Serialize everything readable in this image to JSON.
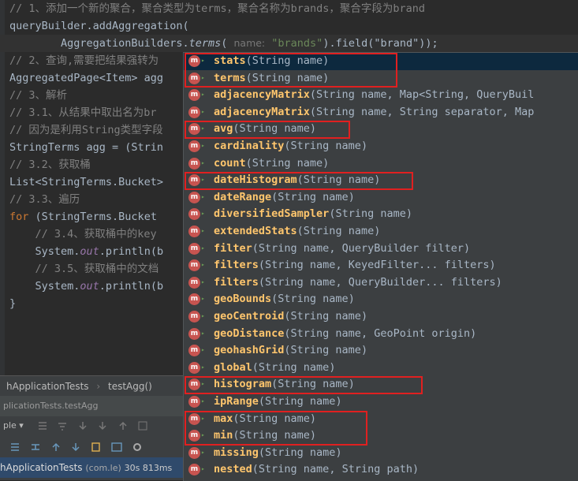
{
  "code": {
    "line1": "// 1、添加一个新的聚合，聚合类型为terms，聚合名称为brands，聚合字段为brand",
    "line2": "queryBuilder.addAggregation(",
    "line3_pre": "        AggregationBuilders.",
    "line3_method": "terms",
    "line3_paren": "( ",
    "line3_hint": "name:",
    "line3_string": " \"brands\"",
    "line3_post": ").field(\"brand\"));",
    "line4": "// 2、查询,需要把结果强转为",
    "line5": "AggregatedPage<Item> agg",
    "line6": "// 3、解析",
    "line7": "// 3.1、从结果中取出名为br",
    "line8": "// 因为是利用String类型字段",
    "line9": "StringTerms agg = (Strin",
    "line10": "// 3.2、获取桶",
    "line11": "List<StringTerms.Bucket>",
    "line12": "// 3.3、遍历",
    "line13_kw": "for",
    "line13_rest": " (StringTerms.Bucket",
    "line14": "    // 3.4、获取桶中的key",
    "line15_pre": "    System.",
    "line15_field": "out",
    "line15_post": ".println(b",
    "line16": "    // 3.5、获取桶中的文档",
    "line17_pre": "    System.",
    "line17_field": "out",
    "line17_post": ".println(b",
    "line18": "}"
  },
  "completion": {
    "badge_letter": "m",
    "items": [
      {
        "name": "stats",
        "params": "(String name)"
      },
      {
        "name": "terms",
        "params": "(String name)"
      },
      {
        "name": "adjacencyMatrix",
        "params": "(String name, Map<String, QueryBuil"
      },
      {
        "name": "adjacencyMatrix",
        "params": "(String name, String separator, Map"
      },
      {
        "name": "avg",
        "params": "(String name)"
      },
      {
        "name": "cardinality",
        "params": "(String name)"
      },
      {
        "name": "count",
        "params": "(String name)"
      },
      {
        "name": "dateHistogram",
        "params": "(String name)"
      },
      {
        "name": "dateRange",
        "params": "(String name)"
      },
      {
        "name": "diversifiedSampler",
        "params": "(String name)"
      },
      {
        "name": "extendedStats",
        "params": "(String name)"
      },
      {
        "name": "filter",
        "params": "(String name, QueryBuilder filter)"
      },
      {
        "name": "filters",
        "params": "(String name, KeyedFilter... filters)"
      },
      {
        "name": "filters",
        "params": "(String name, QueryBuilder... filters)"
      },
      {
        "name": "geoBounds",
        "params": "(String name)"
      },
      {
        "name": "geoCentroid",
        "params": "(String name)"
      },
      {
        "name": "geoDistance",
        "params": "(String name, GeoPoint origin)"
      },
      {
        "name": "geohashGrid",
        "params": "(String name)"
      },
      {
        "name": "global",
        "params": "(String name)"
      },
      {
        "name": "histogram",
        "params": "(String name)"
      },
      {
        "name": "ipRange",
        "params": "(String name)"
      },
      {
        "name": "max",
        "params": "(String name)"
      },
      {
        "name": "min",
        "params": "(String name)"
      },
      {
        "name": "missing",
        "params": "(String name)"
      },
      {
        "name": "nested",
        "params": "(String name, String path)"
      }
    ]
  },
  "bottom": {
    "breadcrumb_class": "hApplicationTests",
    "breadcrumb_sep": "›",
    "breadcrumb_method": "testAgg()",
    "run_tab": "plicationTests.testAgg",
    "toolbar_label": "ple ▾",
    "result_name": "hApplicationTests",
    "result_pkg": "(com.le)",
    "result_time": "30s 813ms"
  },
  "colors": {
    "editor_bg": "#2b2b2b",
    "popup_bg": "#3c3f41",
    "highlight_box": "#e02020",
    "method_badge": "#c75450"
  }
}
